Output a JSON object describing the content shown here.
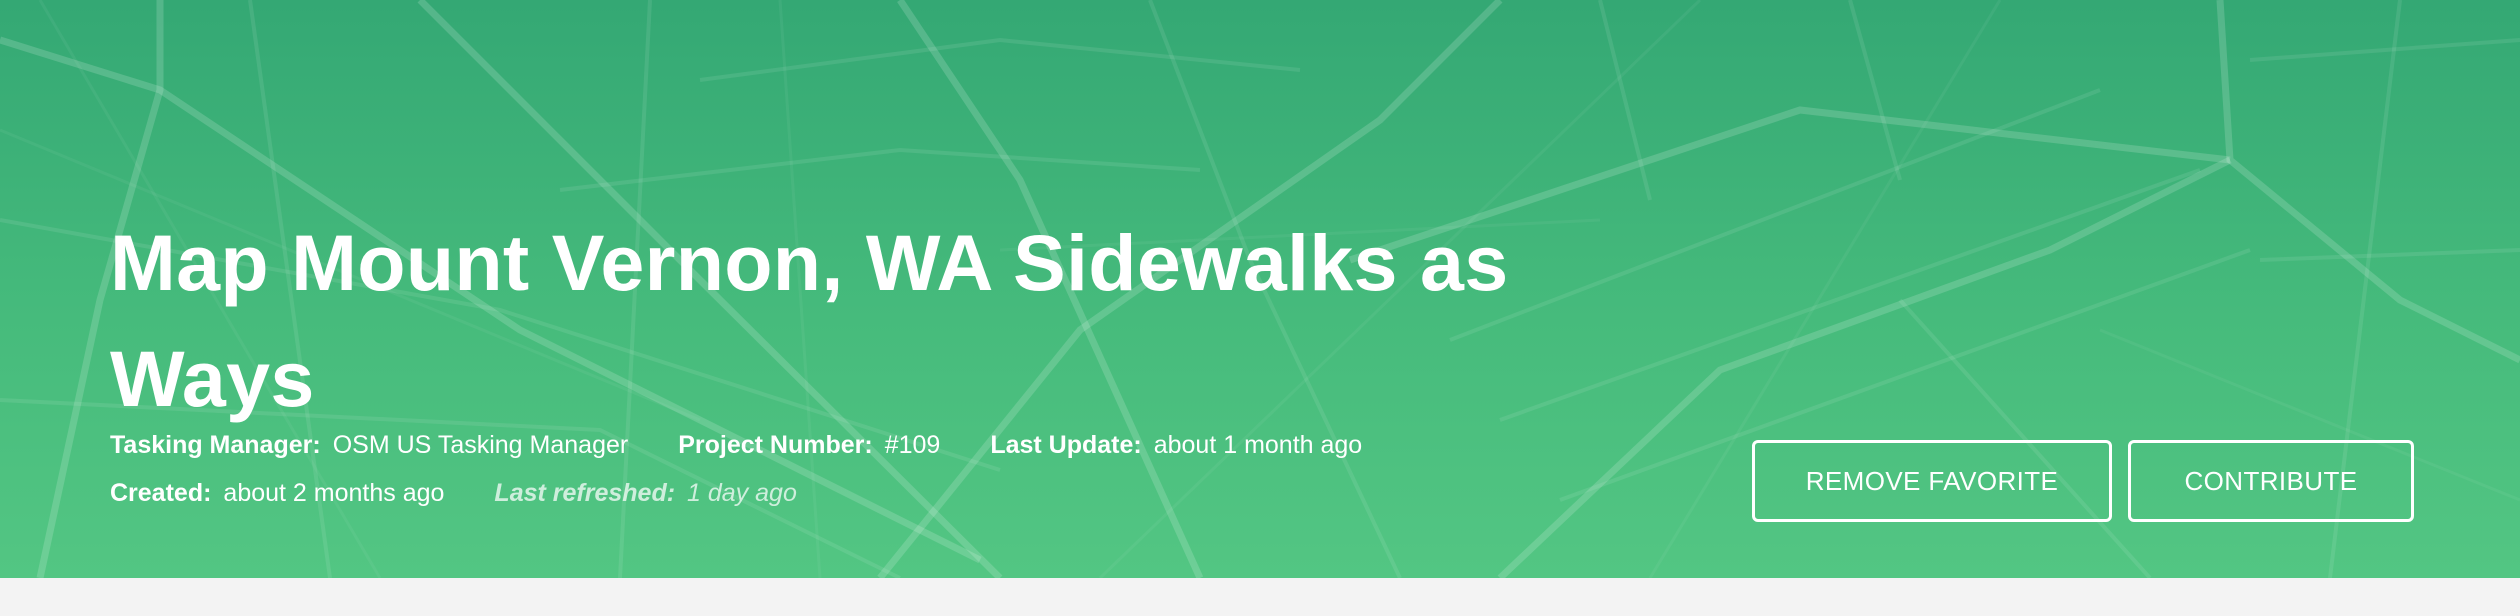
{
  "project": {
    "title": "Map Mount Vernon, WA Sidewalks as Ways"
  },
  "meta": {
    "tasking_manager_label": "Tasking Manager:",
    "tasking_manager_value": "OSM US Tasking Manager",
    "project_number_label": "Project Number:",
    "project_number_value": "#109",
    "last_update_label": "Last Update:",
    "last_update_value": "about 1 month ago",
    "created_label": "Created:",
    "created_value": "about 2 months ago",
    "last_refreshed_label": "Last refreshed:",
    "last_refreshed_value": "1 day ago"
  },
  "actions": {
    "remove_favorite_label": "REMOVE FAVORITE",
    "contribute_label": "CONTRIBUTE"
  },
  "colors": {
    "hero_top": "#34a874",
    "hero_bottom": "#53c683",
    "text": "#ffffff",
    "page_background": "#f3f3f3"
  }
}
